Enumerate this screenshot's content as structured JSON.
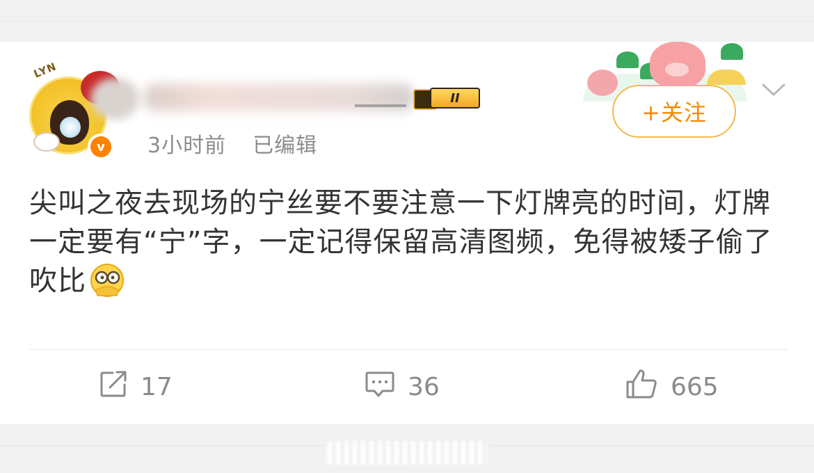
{
  "post": {
    "time": "3小时前",
    "edited": "已编辑",
    "level_badge": "II",
    "verified_badge": "v",
    "avatar_text": "LYN",
    "text": "尖叫之夜去现场的宁丝要不要注意一下灯牌亮的时间，灯牌一定要有“宁”字，一定记得保留高清图频，免得被矮子偷了吹比",
    "emoji": "facepalm-peek-emoji"
  },
  "follow_button": {
    "label": "+关注"
  },
  "actions": {
    "repost": {
      "icon": "repost-icon",
      "count": "17"
    },
    "comment": {
      "icon": "comment-icon",
      "count": "36"
    },
    "like": {
      "icon": "thumbs-up-icon",
      "count": "665"
    }
  },
  "colors": {
    "accent_orange": "#f48a00",
    "follow_border": "#f6b94a",
    "text_main": "#333333",
    "text_meta": "#8c8c8c",
    "background": "#f2f2f2",
    "card": "#ffffff"
  }
}
